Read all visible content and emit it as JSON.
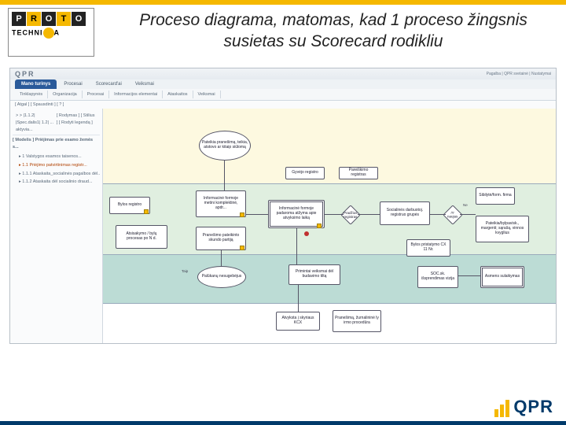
{
  "logo": {
    "letters": [
      "P",
      "R",
      "O",
      "T",
      "O"
    ],
    "line2": "TECHNI",
    "suffix": "A"
  },
  "title": "Proceso diagrama, matomas, kad 1 proceso žingsnis susietas su Scorecard rodikliu",
  "app": {
    "brand": "QPR",
    "header_links": "Pagalba  |  QPR svetainė  |  Nustatymai",
    "tabs": [
      {
        "label": "Mano turinys",
        "active": true
      },
      {
        "label": "Procesai"
      },
      {
        "label": "Scorecard'ai"
      },
      {
        "label": "Veiksmai"
      }
    ],
    "subtabs": [
      "Tinklapynės",
      "Organizacija",
      "Procesai",
      "Informacijos elementai",
      "Ataskaitos",
      "Veiksmai"
    ],
    "toolbar_left": "[ Atgal ]  [ Spausdinti ]  [ ? ]",
    "toolbar_right": "[ Rodymas ]  [ Stilius ]  [ Rodyti legendą ]",
    "crumb_left": "> > |1.1.2| ĮSpec.dalis1| 1.2| ... aktyvia...",
    "sidebar": {
      "title": "[ Modelis ]  Priėjimas prie esamo žemės s...",
      "items": [
        {
          "label": "1 Valstygos esamos taisenos..."
        },
        {
          "label": "1.1 Priėjimo patvirtinimas registr...",
          "sel": true
        },
        {
          "label": "1.1.1 Ataskaita_socialinės pagalbos dėl..."
        },
        {
          "label": "1.1.2 Ataskaita dėl socialinio draud..."
        }
      ]
    },
    "nodes": {
      "n1": "Pateikia pranešimą, teikia, atstovo ar kitaip siūlomą",
      "n2": "Bylos registro",
      "n3": "Informacinė formoje metini komplektinė, apdr...",
      "n4": "Pranešimo pateikinto skundo partiją",
      "n5": "Informacinė formoje padaroma atžyma apie atvyksimo laiką",
      "n6": "Gyvėjo registro",
      "n7": "Atsisakymo / bylų procesas po N d.",
      "n8": "Pareiškimo registras",
      "n9": "Palūkanų nesugebėjus",
      "n10": "Primintai veiksmai dėl budavimo tiltą",
      "n11": "Socialinės darbuotoj. registruo grupės",
      "n12": "Sibilytė/form. firma",
      "n13": "Pateikia/bylpavisk., margenti; sąrašą, vinnos kvyglius",
      "n14": "Bylos pristatymo CX 11 Nr.",
      "n15": "SOC.sk. išsprendimas vizija",
      "n16": "Asmens sulaikymas",
      "n17": "Atvyksta į skyriaus KCX",
      "n18": "Pranešimą, žurnalininė ly irmo procedūra"
    },
    "labels": {
      "taip": "Taip",
      "ne": "Ne",
      "dec1": "Pradžios registras",
      "dec2": "Ar naujas"
    }
  },
  "footer": {
    "brand": "QPR"
  }
}
